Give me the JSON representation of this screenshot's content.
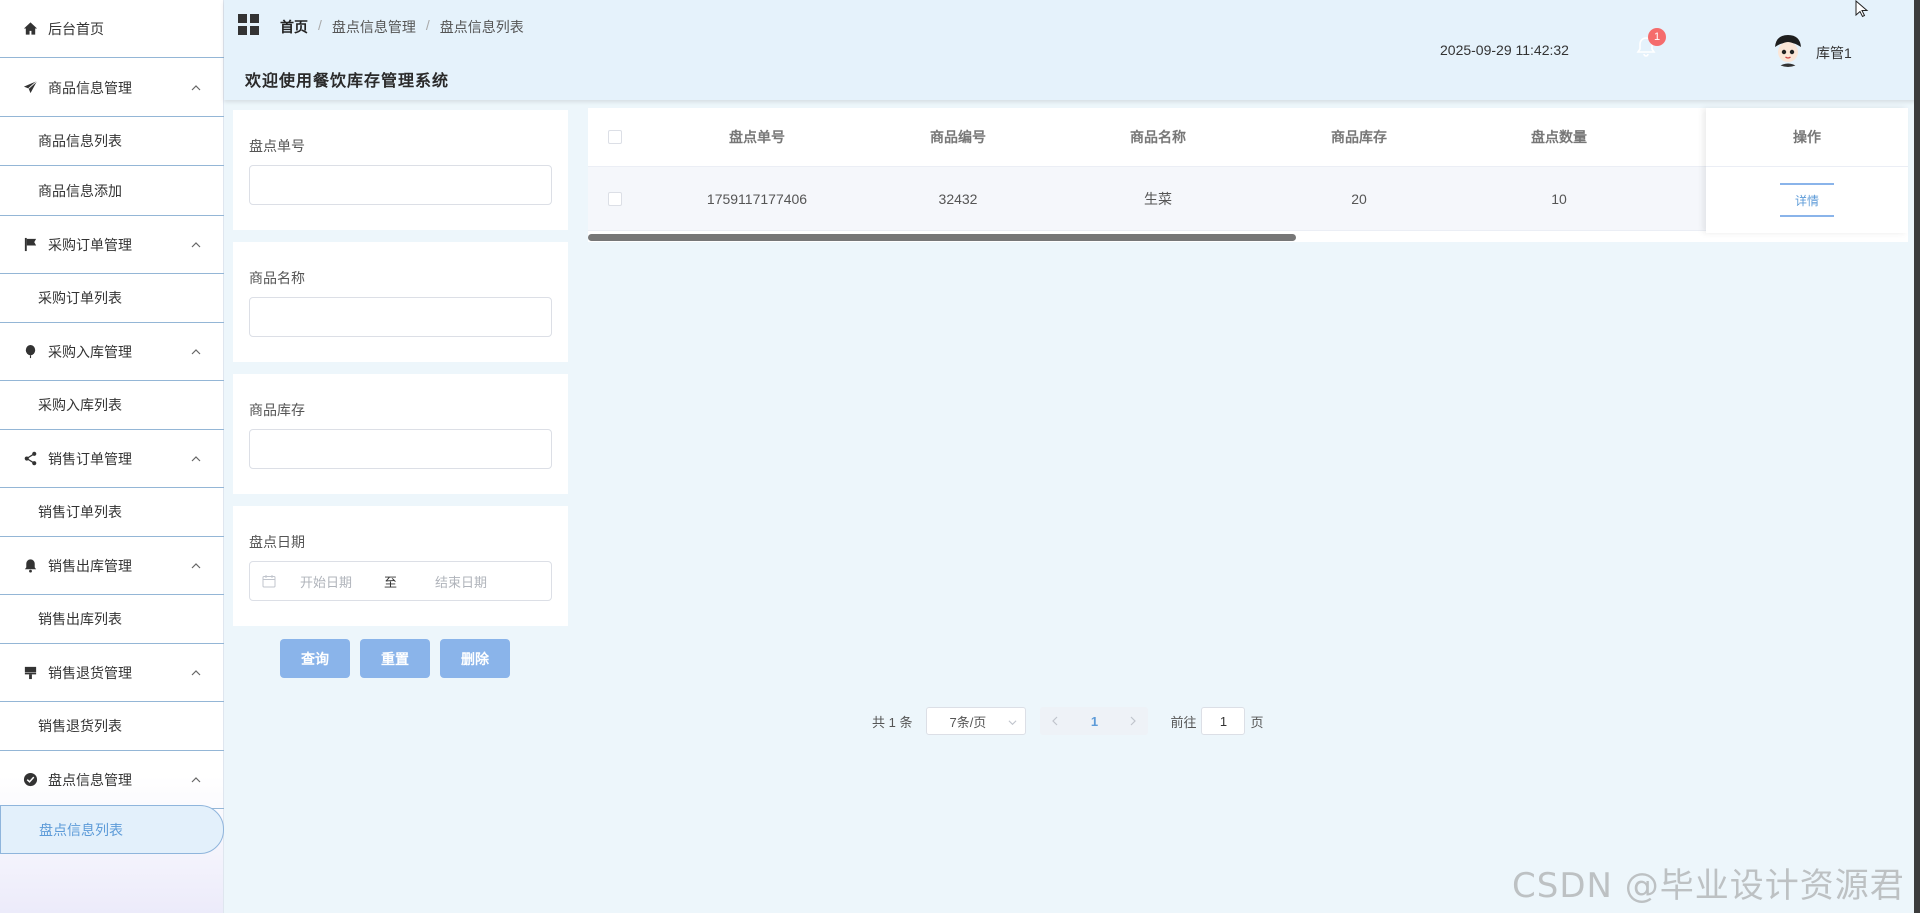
{
  "sidebar": {
    "home": "后台首页",
    "groups": [
      {
        "icon": "paper-plane-icon",
        "label": "商品信息管理",
        "items": [
          "商品信息列表",
          "商品信息添加"
        ]
      },
      {
        "icon": "flag-icon",
        "label": "采购订单管理",
        "items": [
          "采购订单列表"
        ]
      },
      {
        "icon": "balloon-icon",
        "label": "采购入库管理",
        "items": [
          "采购入库列表"
        ]
      },
      {
        "icon": "share-icon",
        "label": "销售订单管理",
        "items": [
          "销售订单列表"
        ]
      },
      {
        "icon": "bell-icon",
        "label": "销售出库管理",
        "items": [
          "销售出库列表"
        ]
      },
      {
        "icon": "brush-icon",
        "label": "销售退货管理",
        "items": [
          "销售退货列表"
        ]
      },
      {
        "icon": "check-circle-icon",
        "label": "盘点信息管理",
        "items": [
          "盘点信息列表"
        ]
      }
    ],
    "active_item": "盘点信息列表"
  },
  "header": {
    "breadcrumb": [
      "首页",
      "盘点信息管理",
      "盘点信息列表"
    ],
    "welcome": "欢迎使用餐饮库存管理系统",
    "datetime": "2025-09-29 11:42:32",
    "notification_count": "1",
    "username": "库管1"
  },
  "search": {
    "fields": {
      "order_no": {
        "label": "盘点单号",
        "value": ""
      },
      "goods_name": {
        "label": "商品名称",
        "value": ""
      },
      "stock": {
        "label": "商品库存",
        "value": ""
      },
      "date": {
        "label": "盘点日期",
        "start_placeholder": "开始日期",
        "to": "至",
        "end_placeholder": "结束日期"
      }
    },
    "buttons": {
      "query": "查询",
      "reset": "重置",
      "delete": "删除"
    }
  },
  "table": {
    "columns": [
      "盘点单号",
      "商品编号",
      "商品名称",
      "商品库存",
      "盘点数量",
      "操作"
    ],
    "rows": [
      {
        "order_no": "1759117177406",
        "goods_no": "32432",
        "goods_name": "生菜",
        "stock": "20",
        "count": "10",
        "action": "详情"
      }
    ]
  },
  "pagination": {
    "total": "共 1 条",
    "page_size": "7条/页",
    "current_page": "1",
    "goto_label": "前往",
    "goto_value": "1",
    "page_suffix": "页"
  },
  "watermark": "CSDN @毕业设计资源君",
  "colors": {
    "accent": "#8ab4ea",
    "active_text": "#5d9bd8",
    "header_bg": "#e5f2fb",
    "page_bg": "#edf6fb",
    "badge": "#f56c6c"
  }
}
